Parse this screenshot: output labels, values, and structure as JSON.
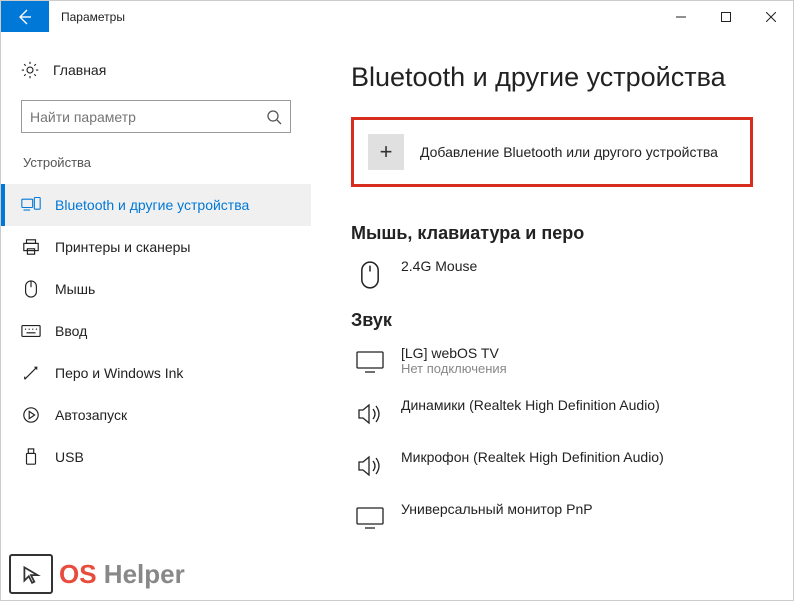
{
  "window": {
    "title": "Параметры"
  },
  "sidebar": {
    "home": "Главная",
    "search_placeholder": "Найти параметр",
    "section": "Устройства",
    "items": [
      {
        "label": "Bluetooth и другие устройства"
      },
      {
        "label": "Принтеры и сканеры"
      },
      {
        "label": "Мышь"
      },
      {
        "label": "Ввод"
      },
      {
        "label": "Перо и Windows Ink"
      },
      {
        "label": "Автозапуск"
      },
      {
        "label": "USB"
      }
    ]
  },
  "content": {
    "title": "Bluetooth и другие устройства",
    "add_device": "Добавление Bluetooth или другого устройства",
    "section_mouse": "Мышь, клавиатура и перо",
    "mouse_device": "2.4G Mouse",
    "section_sound": "Звук",
    "devices_sound": [
      {
        "name": "[LG] webOS TV",
        "sub": "Нет подключения"
      },
      {
        "name": "Динамики (Realtek High Definition Audio)"
      },
      {
        "name": "Микрофон (Realtek High Definition Audio)"
      },
      {
        "name": "Универсальный монитор PnP"
      }
    ]
  },
  "watermark": {
    "os": "OS ",
    "helper": "Helper"
  }
}
